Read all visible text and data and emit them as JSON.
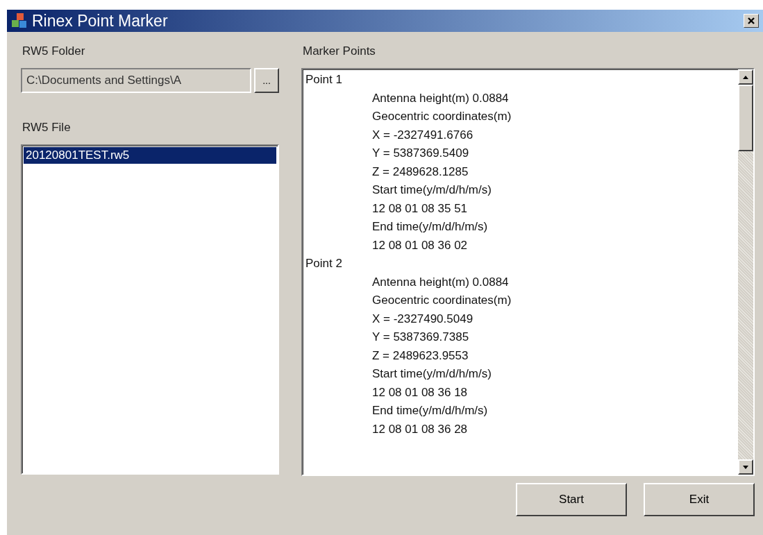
{
  "window": {
    "title": "Rinex Point Marker"
  },
  "folder": {
    "label": "RW5 Folder",
    "value": "C:\\Documents and Settings\\A",
    "browse": "..."
  },
  "files": {
    "label": "RW5 File",
    "items": [
      {
        "name": "20120801TEST.rw5",
        "selected": true
      }
    ]
  },
  "markers": {
    "label": "Marker Points",
    "points": [
      {
        "name": "Point 1",
        "lines": [
          "Antenna height(m) 0.0884",
          "Geocentric coordinates(m)",
          "X = -2327491.6766",
          "Y = 5387369.5409",
          "Z = 2489628.1285",
          "Start time(y/m/d/h/m/s)",
          "12 08 01 08 35 51",
          "End time(y/m/d/h/m/s)",
          "12 08 01 08 36 02"
        ]
      },
      {
        "name": "Point 2",
        "lines": [
          "Antenna height(m) 0.0884",
          "Geocentric coordinates(m)",
          "X = -2327490.5049",
          "Y = 5387369.7385",
          "Z = 2489623.9553",
          "Start time(y/m/d/h/m/s)",
          "12 08 01 08 36 18",
          "End time(y/m/d/h/m/s)",
          "12 08 01 08 36 28"
        ]
      }
    ]
  },
  "buttons": [
    "Start",
    "Exit"
  ]
}
